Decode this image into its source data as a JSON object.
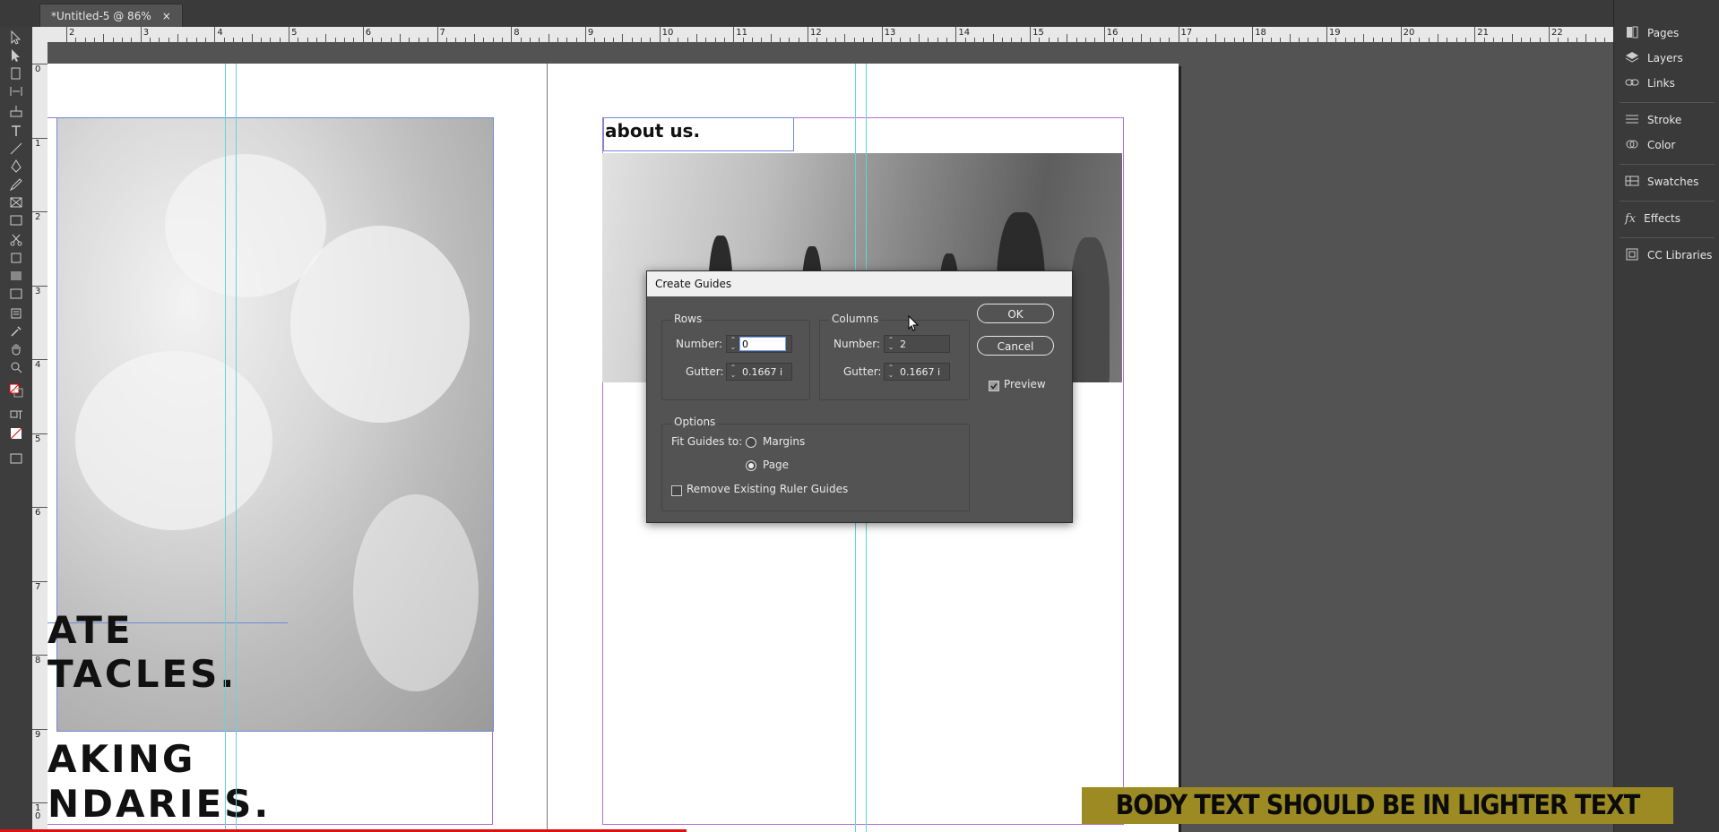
{
  "document": {
    "tab_title": "*Untitled-5 @ 86%",
    "close_glyph": "×"
  },
  "ruler": {
    "h_numbers": [
      "2",
      "3",
      "4",
      "5",
      "6",
      "7",
      "8",
      "9",
      "10",
      "11",
      "12",
      "13",
      "14",
      "15",
      "16",
      "17",
      "18",
      "19",
      "20",
      "21",
      "22"
    ],
    "v_numbers": [
      "0",
      "1",
      "2",
      "3",
      "4",
      "5",
      "6",
      "7",
      "8",
      "9",
      "1\n0"
    ]
  },
  "canvas": {
    "about_text": "about us.",
    "left_texts": [
      "ATE",
      "TACLES.",
      "AKING",
      "NDARIES."
    ]
  },
  "toolbar": {
    "tools": [
      "selection-icon",
      "direct-selection-icon",
      "page-icon",
      "gap-icon",
      "content-collector-icon",
      "type-icon",
      "line-icon",
      "pen-icon",
      "pencil-icon",
      "rectangle-frame-icon",
      "rectangle-icon",
      "scissors-icon",
      "free-transform-icon",
      "gradient-icon",
      "gradient-feather-icon",
      "note-icon",
      "eyedropper-icon",
      "hand-icon",
      "zoom-icon"
    ]
  },
  "panels": [
    {
      "label": "Pages",
      "icon": "pages-icon"
    },
    {
      "label": "Layers",
      "icon": "layers-icon"
    },
    {
      "label": "Links",
      "icon": "links-icon"
    },
    {
      "label": "Stroke",
      "icon": "stroke-icon"
    },
    {
      "label": "Color",
      "icon": "color-icon"
    },
    {
      "label": "Swatches",
      "icon": "swatches-icon"
    },
    {
      "label": "Effects",
      "icon": "fx-icon"
    },
    {
      "label": "CC Libraries",
      "icon": "cc-libraries-icon"
    }
  ],
  "dialog": {
    "title": "Create Guides",
    "rows": {
      "label": "Rows",
      "number_label": "Number:",
      "number_value": "0",
      "gutter_label": "Gutter:",
      "gutter_value": "0.1667 i"
    },
    "columns": {
      "label": "Columns",
      "number_label": "Number:",
      "number_value": "2",
      "gutter_label": "Gutter:",
      "gutter_value": "0.1667 i"
    },
    "ok_label": "OK",
    "cancel_label": "Cancel",
    "preview_label": "Preview",
    "preview_checked": true,
    "options": {
      "label": "Options",
      "fit_label": "Fit Guides to:",
      "margins_label": "Margins",
      "page_label": "Page",
      "selected": "Page",
      "remove_label": "Remove Existing Ruler Guides",
      "remove_checked": false
    }
  },
  "caption": "BODY TEXT SHOULD BE IN LIGHTER TEXT",
  "colors": {
    "guide": "#5fd6d6",
    "margin": "#b06fd0",
    "frame": "#6e8cd2",
    "caption_bg": "#9c8a22"
  }
}
